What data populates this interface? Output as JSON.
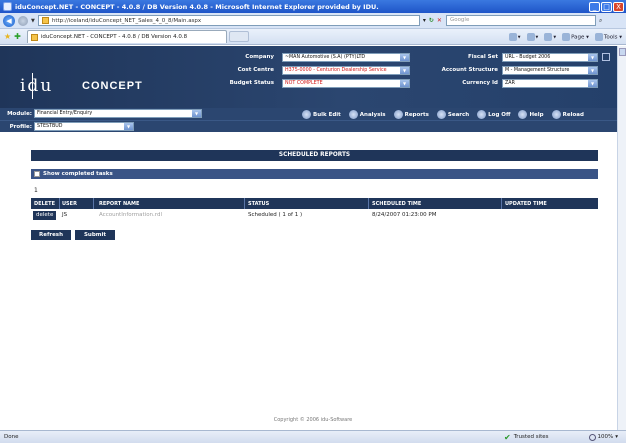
{
  "window": {
    "title": "iduConcept.NET - CONCEPT - 4.0.8 / DB Version 4.0.8 - Microsoft Internet Explorer provided by IDU.",
    "minimize": "_",
    "maximize": "□",
    "close": "X"
  },
  "browser": {
    "url": "http://iceland/iduConcept_NET_Sales_4_0_8/Main.aspx",
    "search_placeholder": "Google",
    "tab_title": "iduConcept.NET - CONCEPT - 4.0.8 / DB Version 4.0.8",
    "page_label": "Page",
    "tools_label": "Tools",
    "status": "Done",
    "zone": "Trusted sites",
    "zoom": "100%"
  },
  "header": {
    "logo_idu": "idu",
    "logo_concept": "CONCEPT",
    "company_label": "Company",
    "company_value": "~MAN Automotive (S.A) (PTY)LTD",
    "cost_centre_label": "Cost Centre",
    "cost_centre_value": "H375-0000 - Centurion Dealership Service",
    "budget_status_label": "Budget Status",
    "budget_status_value": "NOT COMPLETE",
    "fiscal_set_label": "Fiscal Set",
    "fiscal_set_value": "URL - Budget 2006",
    "account_structure_label": "Account Structure",
    "account_structure_value": "M - Management Structure",
    "currency_label": "Currency Id",
    "currency_value": "ZAR"
  },
  "modulebar": {
    "module_label": "Module:",
    "module_value": "Financial Entry/Enquiry",
    "profile_label": "Profile:",
    "profile_value": "STESTBUD",
    "links": [
      "Bulk Edit",
      "Analysis",
      "Reports",
      "Search",
      "Log Off",
      "Help",
      "Reload"
    ]
  },
  "content": {
    "section_title": "SCHEDULED REPORTS",
    "show_completed": "Show completed tasks",
    "page_number": "1",
    "columns": [
      "DELETE",
      "USER",
      "REPORT NAME",
      "STATUS",
      "SCHEDULED TIME",
      "UPDATED TIME"
    ],
    "rows": [
      {
        "delete": "delete",
        "user": "JS",
        "report_name": "AccountInformation.rdl",
        "status": "Scheduled ( 1 of 1 )",
        "scheduled_time": "8/24/2007 01:23:00 PM",
        "updated_time": ""
      }
    ],
    "refresh_label": "Refresh",
    "submit_label": "Submit",
    "copyright": "Copyright © 2006 idu-Software"
  }
}
